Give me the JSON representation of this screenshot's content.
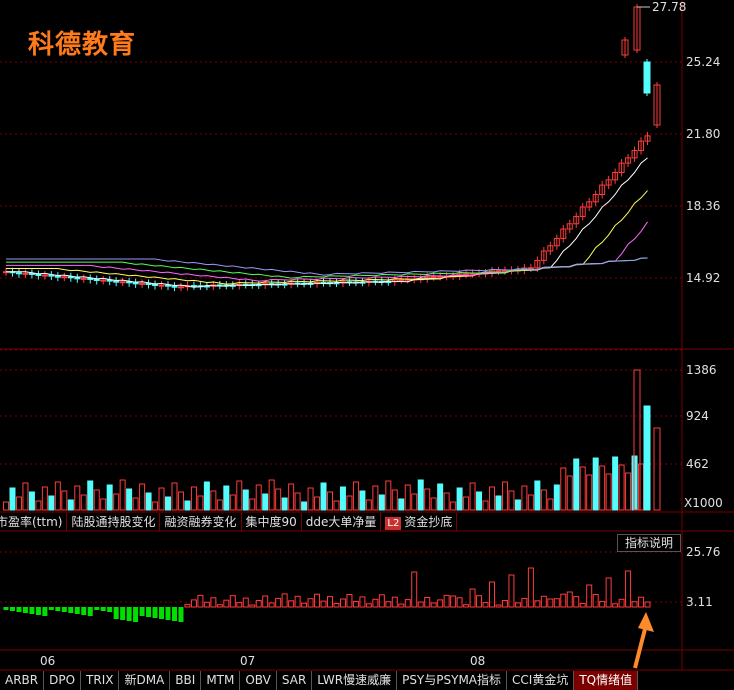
{
  "brand": {
    "logo_text": "科德教育"
  },
  "price_axis": {
    "max_label": "27.78",
    "ticks": [
      "25.24",
      "21.80",
      "18.36",
      "14.92"
    ]
  },
  "volume_axis": {
    "ticks": [
      "1386",
      "924",
      "462"
    ],
    "unit": "X1000"
  },
  "indicator_axis": {
    "ticks": [
      "25.76",
      "3.11"
    ]
  },
  "indicator_tabs": [
    {
      "label": "市盈率(ttm)"
    },
    {
      "label": "陆股通持股变化"
    },
    {
      "label": "融资融券变化"
    },
    {
      "label": "集中度90"
    },
    {
      "label": "dde大单净量"
    },
    {
      "badge": "L2",
      "label": "资金抄底"
    }
  ],
  "help_button": "指标说明",
  "time_axis": [
    "06",
    "07",
    "08"
  ],
  "bottom_tabs": [
    {
      "label": "ARBR"
    },
    {
      "label": "DPO"
    },
    {
      "label": "TRIX"
    },
    {
      "label": "新DMA"
    },
    {
      "label": "BBI"
    },
    {
      "label": "MTM"
    },
    {
      "label": "OBV"
    },
    {
      "label": "SAR"
    },
    {
      "label": "LWR慢速威廉"
    },
    {
      "label": "PSY与PSYMA指标"
    },
    {
      "label": "CCI黄金坑"
    },
    {
      "label": "TQ情绪值"
    }
  ],
  "colors": {
    "up": "#ff3c3c",
    "down": "#54fcfc",
    "grid": "#7a0000",
    "bar_pos": "#ff3c3c",
    "bar_neg": "#00e000",
    "arrow": "#ff8a2a"
  }
}
